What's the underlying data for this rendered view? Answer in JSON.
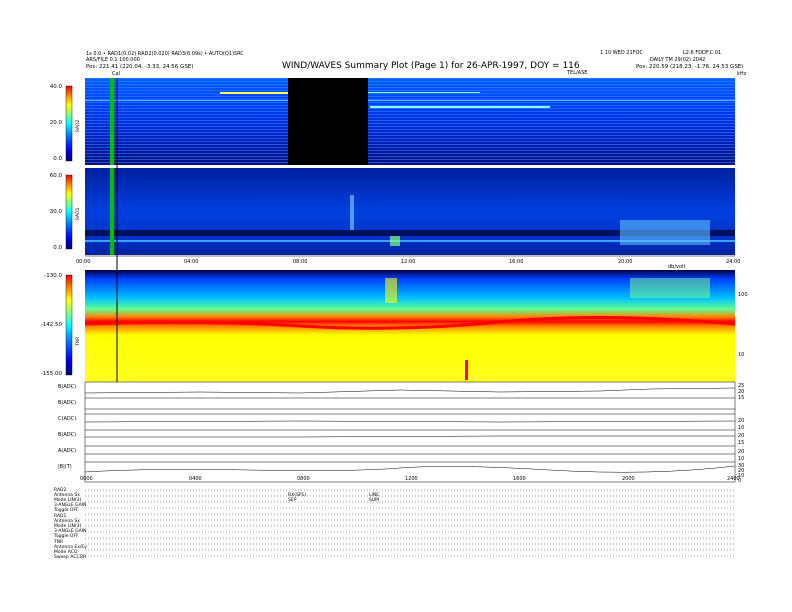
{
  "header": {
    "left_line1": "1s 0.0 • RAD1(0.02) RAD2(0.020) RAD3(6.09s) • AUTO(Q1)SRC",
    "left_line2": "ARS/FILE 0.1 100.000",
    "left_pos": "Pos:   221.41 (220.04, -3.33, 24.56 GSE)",
    "center_title": "WIND/WAVES Summary Plot (Page 1) for 26-APR-1997, DOY = 116",
    "center_sub": "TEL/ASE",
    "right_line1": "1.10 WED 21FOC",
    "right_line1b": "L2.6 FDDF.C:01",
    "right_line2": "DAILY TM 29(02) 2042",
    "right_pos": "Pos:   220.59 (218.23, -1.76, 24.53 GSE)"
  },
  "marker_label": "Cal",
  "panels": {
    "rad2": {
      "label": "RAD2",
      "cbar_ticks": [
        "40.0",
        "20.0",
        "0.0"
      ]
    },
    "rad1": {
      "label": "RAD1",
      "cbar_ticks": [
        "60.0",
        "30.0",
        "0.0"
      ]
    },
    "tnr": {
      "label": "TNR",
      "cbar_ticks": [
        "-130.0",
        "-142.50",
        "-155.00"
      ],
      "right_ticks": [
        "100",
        "10"
      ],
      "right_header": "db/volt"
    },
    "rad1_right": "kHz"
  },
  "time_axis": {
    "ticks": [
      "00:00",
      "04:00",
      "08:00",
      "12:00",
      "16:00",
      "20:00",
      "24:00"
    ]
  },
  "line_panels": [
    {
      "label": "B(ADC)",
      "right": [
        "25",
        "20",
        "15"
      ]
    },
    {
      "label": "B(ADC)",
      "right": []
    },
    {
      "label": "C(ADC)",
      "right": [
        "20",
        "10"
      ]
    },
    {
      "label": "B(ADC)",
      "right": [
        "20",
        "15"
      ]
    },
    {
      "label": "A(ADC)",
      "right": [
        "20",
        "10"
      ]
    },
    {
      "label": "|B|(T)",
      "right": [
        "30",
        "20",
        "10",
        "0"
      ]
    }
  ],
  "bottom_axis": {
    "ticks": [
      "0000",
      "0400",
      "0800",
      "1200",
      "1600",
      "2000",
      "2400"
    ]
  },
  "bottom_block": {
    "col1": [
      "RAD2",
      "Antenna     Sx",
      "Mode   LIN(3)",
      "3-ANGLE  GAIN",
      "Toggle     OFF",
      "RAD1",
      "Antenna     Sx",
      "Mode   LIN(3)",
      "3-ANGLE  GAIN",
      "Toggle     OFF",
      "TNR",
      "Antenna   Ex/Ey",
      "Mode       ACQ",
      "Sweep   ACCOR"
    ],
    "col2": [
      "RX(SP1)",
      "SEP"
    ],
    "col3": [
      "LINE",
      "SUM"
    ]
  },
  "chart_data": {
    "type": "heatmap",
    "title": "WIND/WAVES Summary Plot (Page 1) for 26-APR-1997, DOY = 116",
    "x_range": [
      "00:00",
      "24:00"
    ],
    "colormap": [
      "#000080",
      "#0000ff",
      "#0080ff",
      "#00ffff",
      "#80ff80",
      "#ffff00",
      "#ff8000",
      "#ff0000"
    ],
    "panels": [
      {
        "name": "RAD2",
        "zrange": [
          0,
          40
        ]
      },
      {
        "name": "RAD1",
        "zrange": [
          0,
          60
        ]
      },
      {
        "name": "TNR",
        "zrange": [
          -155,
          -130
        ]
      }
    ]
  }
}
